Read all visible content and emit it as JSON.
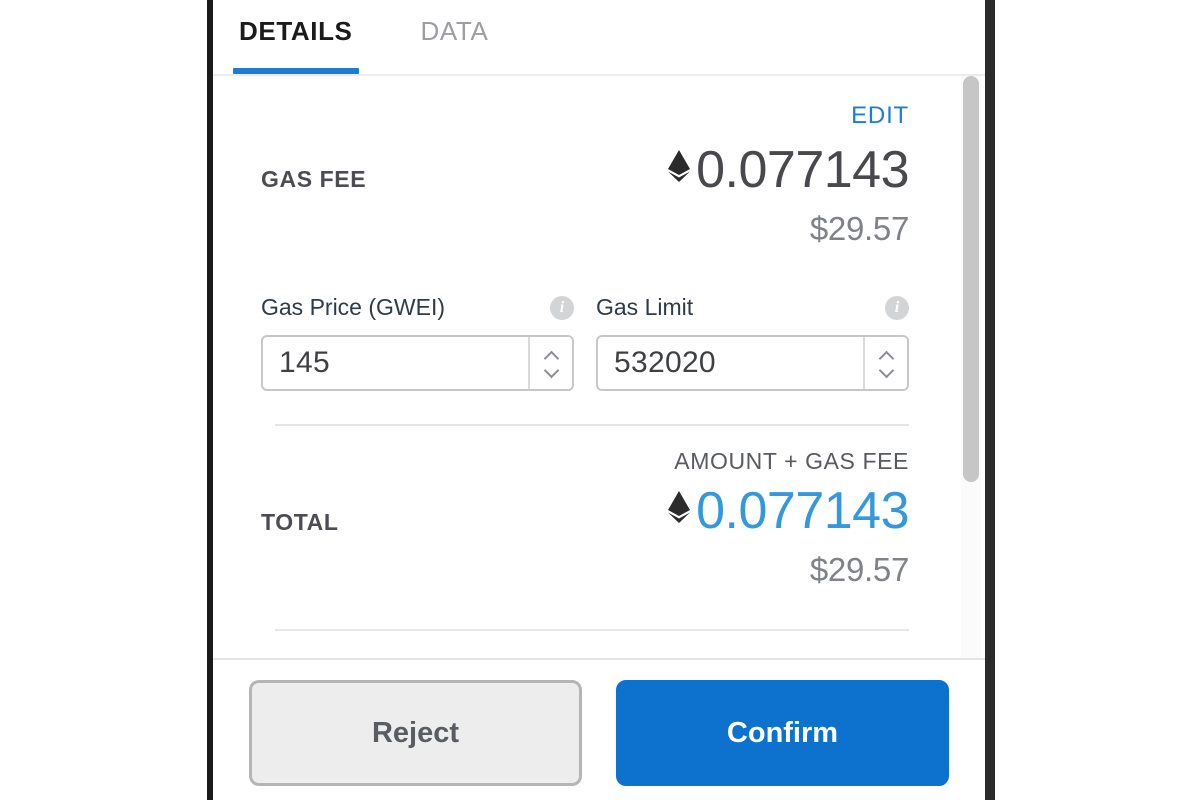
{
  "window": {
    "tabs": [
      {
        "label": "DETAILS",
        "active": true
      },
      {
        "label": "DATA",
        "active": false
      }
    ]
  },
  "details": {
    "edit_label": "EDIT",
    "gas_fee": {
      "label": "GAS FEE",
      "eth_icon": "ethereum-diamond-icon",
      "eth_amount": "0.077143",
      "fiat_amount": "$29.57"
    },
    "gas_price": {
      "label": "Gas Price (GWEI)",
      "info_icon": "info-icon",
      "value": "145",
      "placeholder": "0"
    },
    "gas_limit": {
      "label": "Gas Limit",
      "info_icon": "info-icon",
      "value": "532020",
      "placeholder": "0"
    },
    "total": {
      "caption": "AMOUNT + GAS FEE",
      "label": "TOTAL",
      "eth_icon": "ethereum-diamond-icon",
      "eth_amount": "0.077143",
      "fiat_amount": "$29.57"
    }
  },
  "footer": {
    "reject_label": "Reject",
    "confirm_label": "Confirm"
  },
  "colors": {
    "accent_blue": "#1a7fd4",
    "total_blue": "#3498dd",
    "confirm_blue": "#0d72cd",
    "label_gray": "#4c4c52",
    "fiat_gray": "#7f8287"
  }
}
